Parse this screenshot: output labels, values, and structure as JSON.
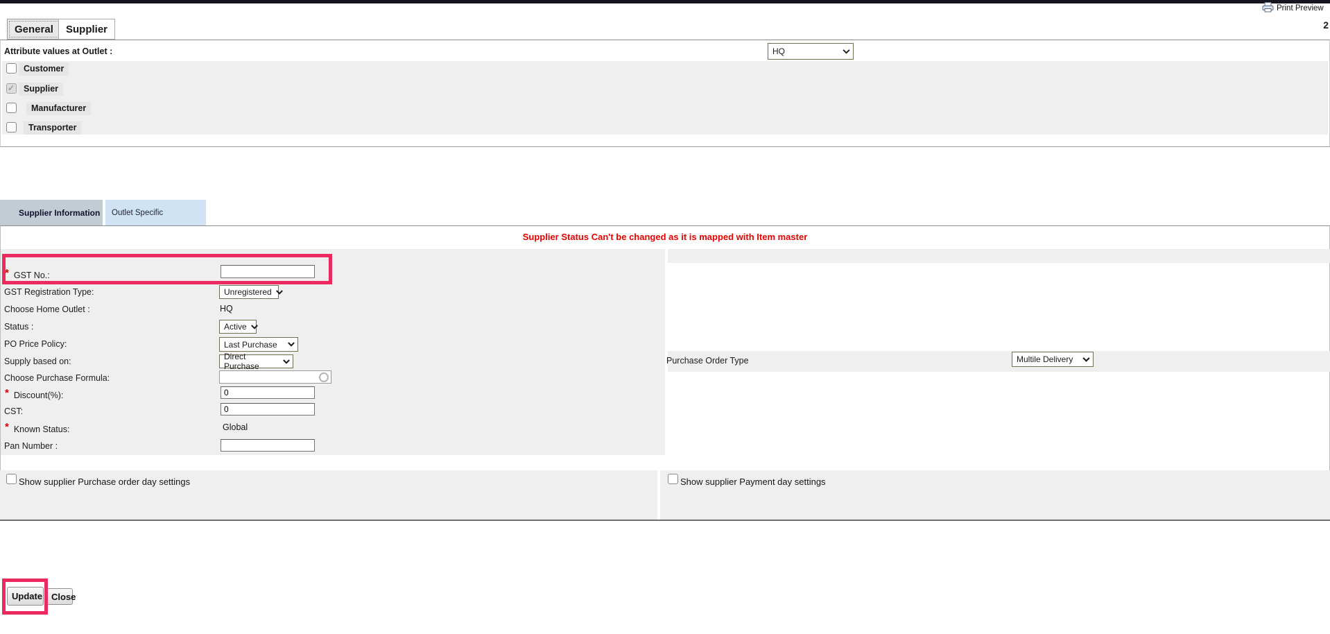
{
  "header": {
    "print_preview_label": "Print Preview",
    "record_count": "2"
  },
  "main_tabs": [
    {
      "label": "General",
      "selected": true
    },
    {
      "label": "Supplier",
      "selected": false
    }
  ],
  "attribute_section": {
    "title": "Attribute values at Outlet :",
    "outlet_select_value": "HQ",
    "checkboxes": [
      {
        "label": "Customer",
        "checked": false,
        "disabled": false
      },
      {
        "label": "Supplier",
        "checked": true,
        "disabled": true
      },
      {
        "label": "Manufacturer",
        "checked": false,
        "disabled": false
      },
      {
        "label": "Transporter",
        "checked": false,
        "disabled": false
      }
    ]
  },
  "supplier_tabs": [
    {
      "label": "Supplier Information",
      "selected": true
    },
    {
      "label": "Outlet Specific",
      "selected": false
    }
  ],
  "error_message": "Supplier Status Can't be changed as it is mapped with Item master",
  "form": {
    "rows": [
      {
        "label": "GST No.:",
        "required": true,
        "control": "input",
        "value": ""
      },
      {
        "label": "GST Registration Type:",
        "required": false,
        "control": "select",
        "value": "Unregistered"
      },
      {
        "label": "Choose Home Outlet :",
        "required": false,
        "control": "text",
        "value": "HQ"
      },
      {
        "label": "Status :",
        "required": false,
        "control": "select",
        "value": "Active"
      },
      {
        "label": "PO Price Policy:",
        "required": false,
        "control": "select",
        "value": "Last Purchase"
      },
      {
        "label": "Supply based on:",
        "required": false,
        "control": "select",
        "value": "Direct Purchase"
      },
      {
        "label": "Choose Purchase Formula:",
        "required": false,
        "control": "input-lookup",
        "value": ""
      },
      {
        "label": "Discount(%):",
        "required": true,
        "control": "input",
        "value": "0"
      },
      {
        "label": "CST:",
        "required": false,
        "control": "input",
        "value": "0"
      },
      {
        "label": "Known Status:",
        "required": true,
        "control": "text",
        "value": "Global"
      },
      {
        "label": "Pan Number :",
        "required": false,
        "control": "input",
        "value": ""
      }
    ]
  },
  "right_panel": {
    "po_type_label": "Purchase Order Type",
    "po_type_value": "Multile Delivery"
  },
  "bottom_toggles": [
    {
      "label": "Show supplier Purchase order day settings",
      "checked": false
    },
    {
      "label": "Show supplier Payment day settings",
      "checked": false
    }
  ],
  "actions": {
    "update_label": "Update",
    "close_label": "Close"
  },
  "colors": {
    "highlight": "#ec2a60",
    "error_text": "#e60000",
    "selected_subtab_bg": "#c2ccd5",
    "subtab_bg": "#d0e3f5",
    "panel_bg": "#efefef",
    "topbar_bg": "#15151f"
  }
}
